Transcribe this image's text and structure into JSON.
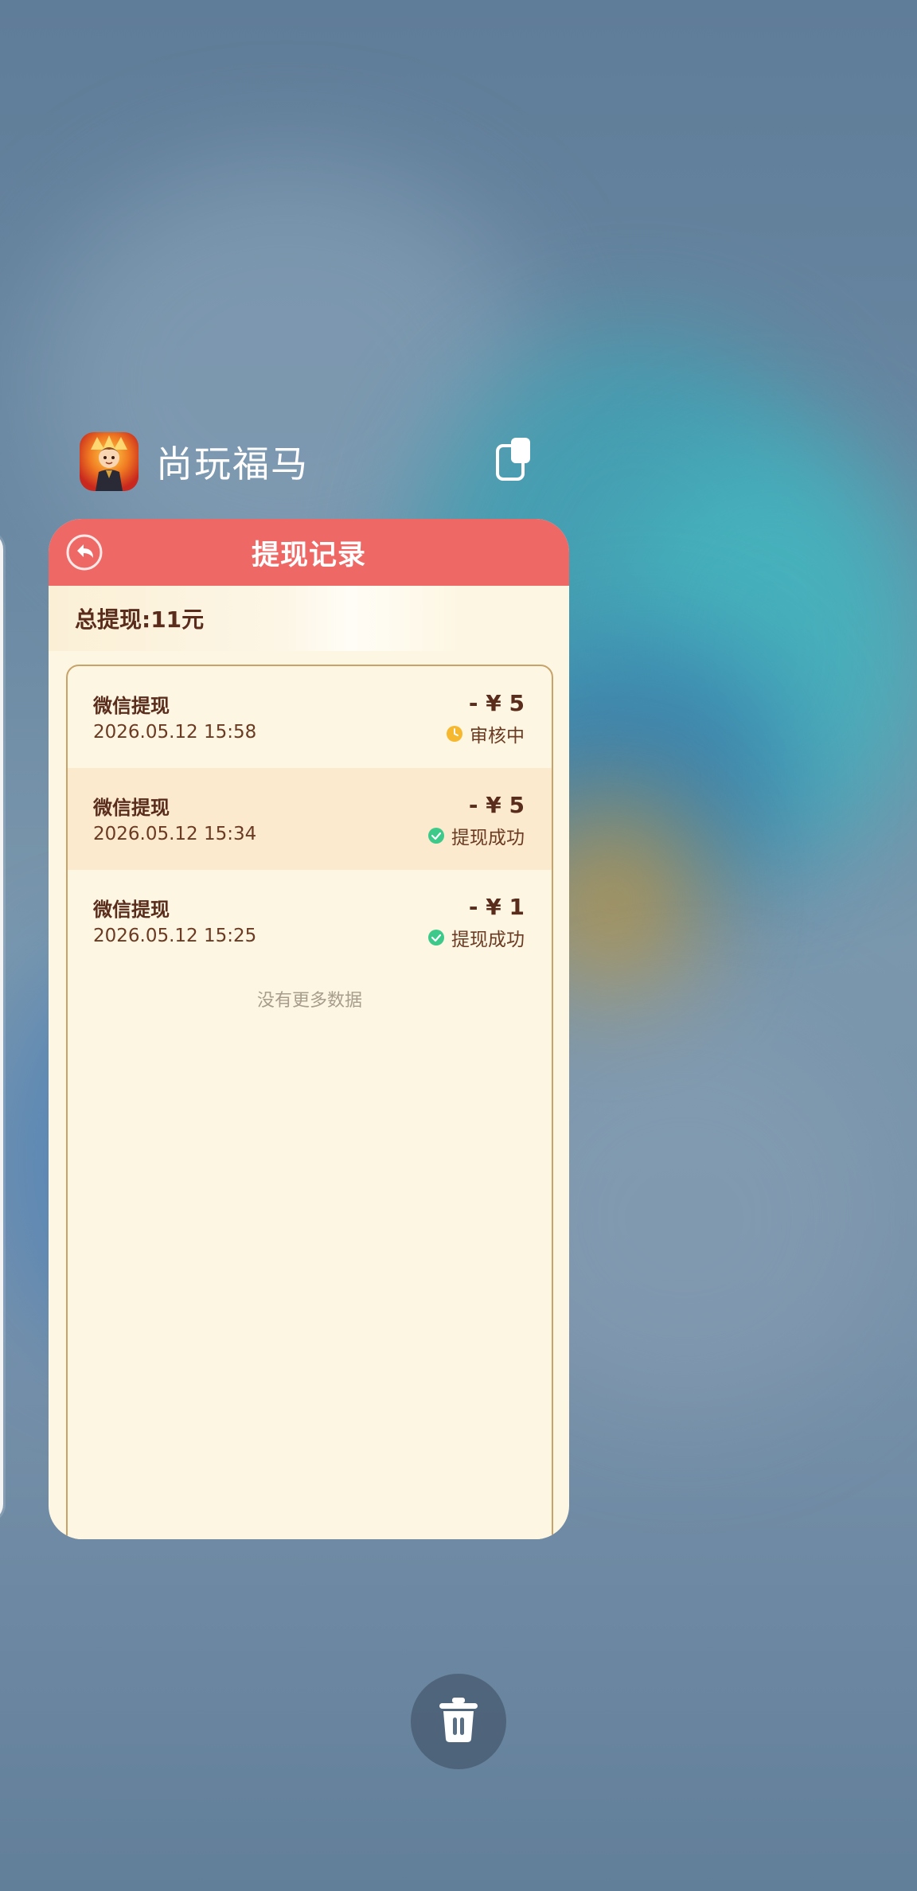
{
  "app": {
    "name": "尚玩福马",
    "icon": "app-avatar-icon"
  },
  "page": {
    "title": "提现记录",
    "total_label": "总提现:11元"
  },
  "records": [
    {
      "name": "微信提现",
      "time": "2026.05.12 15:58",
      "amount": "- ¥ 5",
      "status": "审核中",
      "status_icon": "clock-icon",
      "status_color": "#f5b82e"
    },
    {
      "name": "微信提现",
      "time": "2026.05.12 15:34",
      "amount": "- ¥ 5",
      "status": "提现成功",
      "status_icon": "check-circle-icon",
      "status_color": "#3cc98a"
    },
    {
      "name": "微信提现",
      "time": "2026.05.12 15:25",
      "amount": "- ¥ 1",
      "status": "提现成功",
      "status_icon": "check-circle-icon",
      "status_color": "#3cc98a"
    }
  ],
  "footer_note": "没有更多数据",
  "colors": {
    "header_red": "#ee6966",
    "card_bg": "#fdf6e2",
    "text_brown": "#5a2c1c",
    "panel_border": "#c7a36a"
  }
}
